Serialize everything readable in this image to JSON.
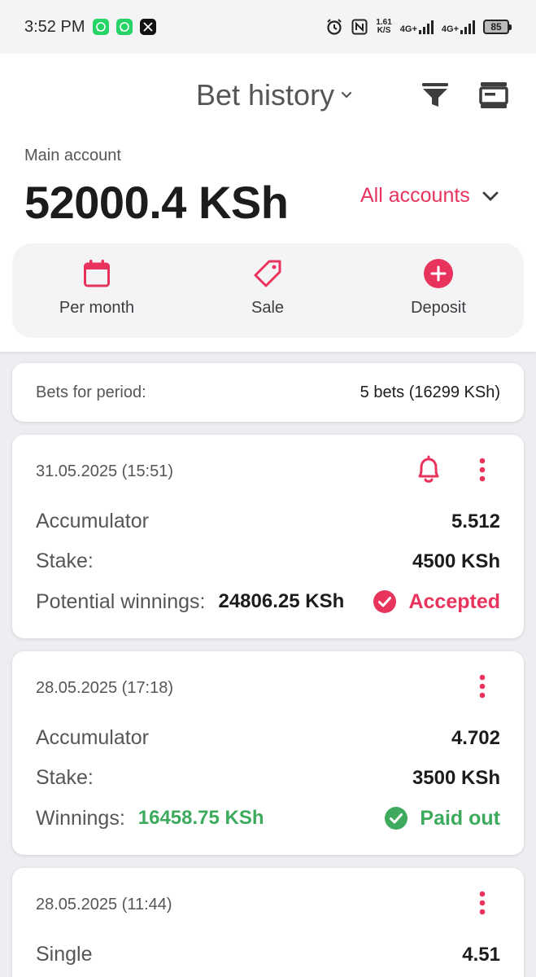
{
  "status_bar": {
    "time": "3:52 PM",
    "notifications": [
      "whatsapp-icon",
      "whatsapp-icon",
      "x-icon"
    ],
    "net_speed": "1.61",
    "net_unit": "K/S",
    "network1": "4G+",
    "network2": "4G+",
    "battery": "85"
  },
  "header": {
    "title": "Bet history"
  },
  "account": {
    "label": "Main account",
    "balance": "52000.4 KSh",
    "selector_label": "All accounts"
  },
  "actions": [
    {
      "label": "Per month",
      "icon": "calendar-icon"
    },
    {
      "label": "Sale",
      "icon": "tag-icon"
    },
    {
      "label": "Deposit",
      "icon": "plus-circle-icon"
    }
  ],
  "period": {
    "label": "Bets for period:",
    "value": "5 bets (16299 KSh)"
  },
  "bets": [
    {
      "date": "31.05.2025 (15:51)",
      "type": "Accumulator",
      "odds": "5.512",
      "stake_label": "Stake:",
      "stake": "4500 KSh",
      "win_label": "Potential winnings:",
      "win_value": "24806.25 KSh",
      "status": "Accepted"
    },
    {
      "date": "28.05.2025 (17:18)",
      "type": "Accumulator",
      "odds": "4.702",
      "stake_label": "Stake:",
      "stake": "3500 KSh",
      "win_label": "Winnings:",
      "win_value": "16458.75 KSh",
      "status": "Paid out"
    },
    {
      "date": "28.05.2025 (11:44)",
      "type": "Single",
      "odds": "4.51"
    }
  ],
  "colors": {
    "accent": "#e8335c",
    "success": "#3daa5e"
  }
}
